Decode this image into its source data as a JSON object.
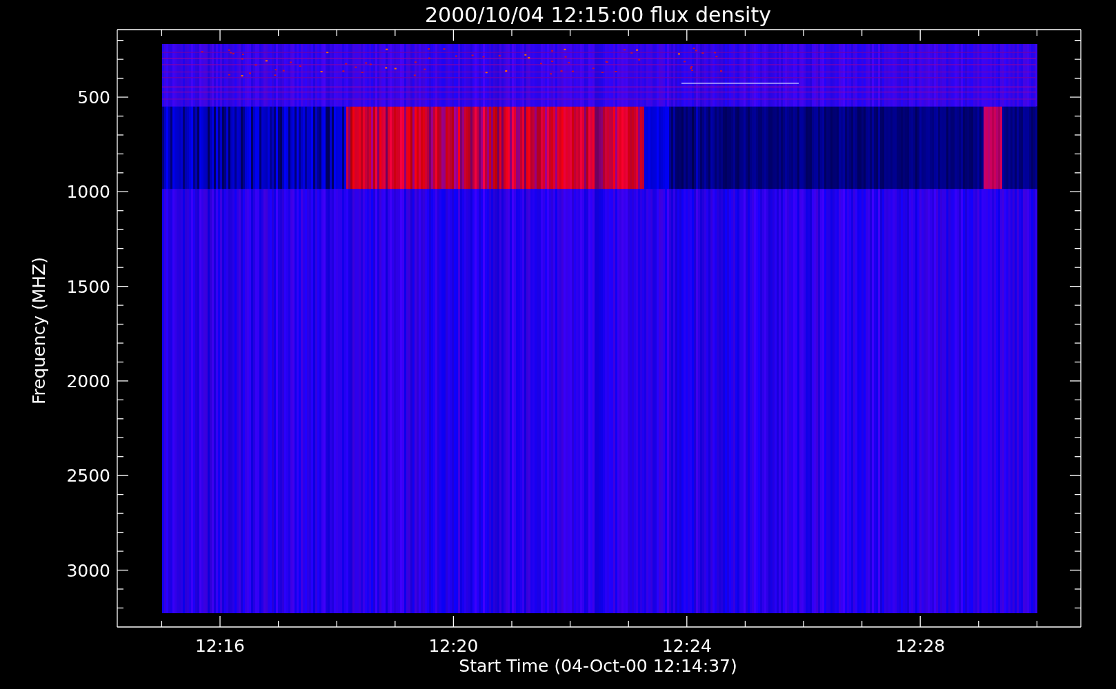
{
  "chart": {
    "title": "2000/10/04 12:15:00 flux density",
    "xlabel": "Start Time (04-Oct-00 12:14:37)",
    "ylabel": "Frequency (MHZ)",
    "xtick_labels": [
      "12:16",
      "12:20",
      "12:24",
      "12:28"
    ],
    "ytick_labels": [
      "500",
      "1000",
      "1500",
      "2000",
      "2500",
      "3000"
    ]
  }
}
